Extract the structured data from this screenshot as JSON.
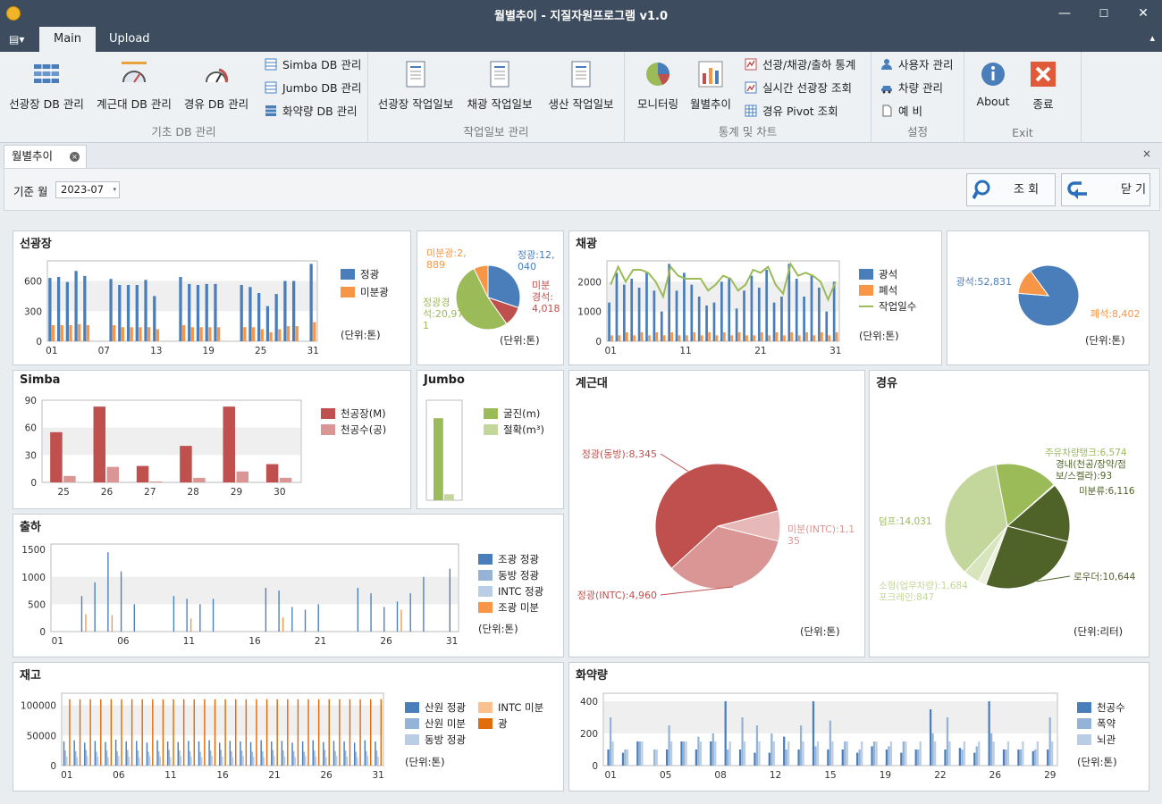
{
  "window": {
    "title": "월별추이 - 지질자원프로그램 v1.0",
    "min": "—",
    "max": "☐",
    "close": "✕"
  },
  "tabs": [
    {
      "label": "Main"
    },
    {
      "label": "Upload"
    }
  ],
  "ribbon": {
    "groups": [
      {
        "caption": "기초 DB 관리",
        "big": [
          {
            "label": "선광장 DB 관리",
            "icon": "list-db-icon"
          },
          {
            "label": "계근대 DB 관리",
            "icon": "gauge-icon"
          },
          {
            "label": "경유 DB 관리",
            "icon": "fuel-gauge-icon"
          }
        ],
        "small": [
          {
            "label": "Simba DB 관리",
            "icon": "grid-icon"
          },
          {
            "label": "Jumbo DB 관리",
            "icon": "grid-icon"
          },
          {
            "label": "화약량 DB 관리",
            "icon": "grid-icon"
          }
        ]
      },
      {
        "caption": "작업일보 관리",
        "big": [
          {
            "label": "선광장 작업일보",
            "icon": "report-icon"
          },
          {
            "label": "채광 작업일보",
            "icon": "report-icon"
          },
          {
            "label": "생산 작업일보",
            "icon": "report-icon"
          }
        ]
      },
      {
        "caption": "통계 및 차트",
        "big": [
          {
            "label": "모니터링",
            "icon": "pie-chart-icon"
          },
          {
            "label": "월별추이",
            "icon": "bar-chart-icon"
          }
        ],
        "small": [
          {
            "label": "선광/채광/출하 통계",
            "icon": "stats-icon"
          },
          {
            "label": "실시간 선광장 조회",
            "icon": "line-chart-icon"
          },
          {
            "label": "경유 Pivot 조회",
            "icon": "table-icon"
          }
        ]
      },
      {
        "caption": "설정",
        "small": [
          {
            "label": "사용자 관리",
            "icon": "user-icon"
          },
          {
            "label": "차량 관리",
            "icon": "car-icon"
          },
          {
            "label": "예 비",
            "icon": "document-icon"
          }
        ]
      },
      {
        "caption": "Exit",
        "big": [
          {
            "label": "About",
            "icon": "info-icon"
          },
          {
            "label": "종료",
            "icon": "close-icon"
          }
        ]
      }
    ]
  },
  "doc_tab": {
    "label": "월별추이",
    "close": "×",
    "panel_close": "×"
  },
  "filter": {
    "label": "기준 월",
    "month": "2023-07",
    "arrow": "▾",
    "search_label": "조 회",
    "close_label": "닫 기"
  },
  "colors": {
    "blue": "#4a7ebb",
    "orange": "#f79646",
    "red": "#c0504d",
    "pink": "#d99694",
    "green": "#9bbb59",
    "lightgreen": "#c3d69b",
    "darkgreen": "#4f6228",
    "lightblue": "#b9cde5",
    "midblue": "#95b3d7",
    "peach": "#fac090"
  },
  "chart_data": [
    {
      "id": "sunkwang",
      "type": "bar",
      "title": "선광장",
      "unit": "(단위:톤)",
      "y_ticks": [
        "0",
        "300",
        "600"
      ],
      "x_ticks": [
        "01",
        "07",
        "13",
        "19",
        "25",
        "31"
      ],
      "ylim": [
        0,
        800
      ],
      "series": [
        {
          "name": "정광",
          "color": "#4a7ebb",
          "values": [
            630,
            640,
            590,
            700,
            650,
            0,
            0,
            620,
            560,
            560,
            560,
            610,
            450,
            0,
            0,
            640,
            570,
            560,
            570,
            570,
            0,
            0,
            560,
            540,
            480,
            350,
            470,
            600,
            600,
            0,
            770
          ]
        },
        {
          "name": "미분광",
          "color": "#f79646",
          "values": [
            160,
            160,
            160,
            170,
            160,
            0,
            0,
            160,
            140,
            140,
            140,
            140,
            120,
            0,
            0,
            160,
            140,
            140,
            140,
            140,
            0,
            0,
            140,
            140,
            120,
            90,
            120,
            150,
            150,
            0,
            190
          ]
        }
      ]
    },
    {
      "id": "sunkwang-pie",
      "type": "pie",
      "unit": "(단위:톤)",
      "slices": [
        {
          "name": "정광",
          "value": 12040,
          "label": "정광:12,040",
          "color": "#4a7ebb"
        },
        {
          "name": "미분경석",
          "value": 4018,
          "label": "미분경석:4,018",
          "color": "#c0504d"
        },
        {
          "name": "정광경석",
          "value": 20971,
          "label": "정광경석:20,971",
          "color": "#9bbb59"
        },
        {
          "name": "미분광",
          "value": 2889,
          "label": "미분광:2,889",
          "color": "#f79646"
        }
      ]
    },
    {
      "id": "chaekwang",
      "type": "bar",
      "title": "채광",
      "unit": "(단위:톤)",
      "y_ticks": [
        "0",
        "1000",
        "2000"
      ],
      "x_ticks": [
        "01",
        "11",
        "21",
        "31"
      ],
      "ylim": [
        0,
        2700
      ],
      "series": [
        {
          "name": "광석",
          "color": "#4a7ebb",
          "values": [
            1300,
            2300,
            1900,
            2100,
            1800,
            2300,
            1700,
            1000,
            2600,
            1700,
            2300,
            1900,
            1500,
            1200,
            1300,
            2000,
            2100,
            1100,
            1700,
            2200,
            1800,
            2400,
            1300,
            1500,
            2600,
            2100,
            1500,
            2200,
            1800,
            1000,
            2000
          ]
        },
        {
          "name": "폐석",
          "color": "#f79646",
          "values": [
            200,
            200,
            300,
            200,
            300,
            200,
            300,
            200,
            300,
            200,
            200,
            300,
            200,
            300,
            200,
            300,
            200,
            300,
            200,
            200,
            300,
            200,
            300,
            200,
            300,
            200,
            300,
            200,
            300,
            200,
            300
          ]
        },
        {
          "name": "작업일수",
          "color": "#9bbb59",
          "line": true,
          "values": [
            1900,
            2500,
            2000,
            2400,
            2400,
            2300,
            2000,
            1500,
            2500,
            2200,
            2100,
            2100,
            2100,
            1700,
            1900,
            2200,
            2100,
            1700,
            1900,
            2400,
            2300,
            2500,
            1900,
            1600,
            2600,
            2200,
            2300,
            2200,
            2000,
            1400,
            2000
          ]
        }
      ]
    },
    {
      "id": "chaekwang-pie",
      "type": "pie",
      "unit": "(단위:톤)",
      "slices": [
        {
          "name": "광석",
          "value": 52831,
          "label": "광석:52,831",
          "color": "#4a7ebb"
        },
        {
          "name": "폐석",
          "value": 8402,
          "label": "폐석:8,402",
          "color": "#f79646"
        }
      ]
    },
    {
      "id": "simba",
      "type": "bar",
      "title": "Simba",
      "y_ticks": [
        "0",
        "30",
        "60",
        "90"
      ],
      "x_ticks": [
        "25",
        "26",
        "27",
        "28",
        "29",
        "30"
      ],
      "ylim": [
        0,
        90
      ],
      "series": [
        {
          "name": "천공장(M)",
          "color": "#c0504d",
          "values": [
            55,
            83,
            18,
            40,
            83,
            20
          ]
        },
        {
          "name": "천공수(공)",
          "color": "#d99694",
          "values": [
            7,
            17,
            1,
            5,
            12,
            5
          ]
        }
      ]
    },
    {
      "id": "jumbo",
      "type": "bar",
      "title": "Jumbo",
      "ylim": [
        0,
        100
      ],
      "series": [
        {
          "name": "굴진(m)",
          "color": "#9bbb59",
          "values": [
            82
          ]
        },
        {
          "name": "절확(m³)",
          "color": "#c3d69b",
          "values": [
            6
          ]
        }
      ]
    },
    {
      "id": "gyegeundae",
      "type": "pie",
      "title": "계근대",
      "unit": "(단위:톤)",
      "slices": [
        {
          "name": "미분(INTC)",
          "value": 1135,
          "label": "미분(INTC):1,135",
          "color": "#e6b9b8"
        },
        {
          "name": "정광(INTC)",
          "value": 4960,
          "label": "정광(INTC):4,960",
          "color": "#d99694"
        },
        {
          "name": "정광(동방)",
          "value": 8345,
          "label": "정광(동방):8,345",
          "color": "#c0504d"
        }
      ]
    },
    {
      "id": "gyeongyu",
      "type": "pie",
      "title": "경유",
      "unit": "(단위:리터)",
      "slices": [
        {
          "name": "주유차량탱크",
          "value": 6574,
          "label": "주유차량탱크:6,574",
          "color": "#9bbb59"
        },
        {
          "name": "경내(천공/장약/점보/스켈라)",
          "value": 93,
          "label": "경내(천공/장약/점보/스켈라):93",
          "color": "#76923c"
        },
        {
          "name": "미분류",
          "value": 6116,
          "label": "미분류:6,116",
          "color": "#4f6228"
        },
        {
          "name": "로우더",
          "value": 10644,
          "label": "로우더:10,644",
          "color": "#4f6228"
        },
        {
          "name": "포크레인",
          "value": 847,
          "label": "포크레인:847",
          "color": "#ebf1de"
        },
        {
          "name": "소형(업무차량)",
          "value": 1684,
          "label": "소형(업무차량):1,684",
          "color": "#d7e4bc"
        },
        {
          "name": "덤프",
          "value": 14031,
          "label": "덤프:14,031",
          "color": "#c3d69b"
        }
      ]
    },
    {
      "id": "chulha",
      "type": "bar",
      "title": "출하",
      "unit": "(단위:톤)",
      "y_ticks": [
        "0",
        "500",
        "1000",
        "1500"
      ],
      "x_ticks": [
        "01",
        "06",
        "11",
        "16",
        "21",
        "26",
        "31"
      ],
      "ylim": [
        0,
        1600
      ],
      "series": [
        {
          "name": "조광 정광",
          "color": "#4a7ebb",
          "values": [
            0,
            0,
            650,
            900,
            1450,
            1100,
            500,
            0,
            0,
            650,
            600,
            500,
            600,
            0,
            0,
            0,
            800,
            750,
            450,
            400,
            500,
            0,
            0,
            800,
            700,
            450,
            550,
            700,
            1000,
            0,
            1150
          ]
        },
        {
          "name": "동방 정광",
          "color": "#95b3d7",
          "values": [
            0,
            0,
            0,
            0,
            0,
            0,
            0,
            0,
            0,
            0,
            0,
            0,
            0,
            0,
            0,
            0,
            0,
            0,
            0,
            0,
            0,
            0,
            0,
            0,
            0,
            0,
            0,
            0,
            0,
            0,
            0
          ]
        },
        {
          "name": "INTC 정광",
          "color": "#b9cde5",
          "values": [
            0,
            0,
            0,
            0,
            0,
            0,
            0,
            0,
            0,
            0,
            0,
            0,
            0,
            0,
            0,
            0,
            0,
            0,
            0,
            0,
            0,
            0,
            0,
            0,
            0,
            0,
            0,
            0,
            0,
            0,
            0
          ]
        },
        {
          "name": "조광 미분",
          "color": "#f79646",
          "values": [
            0,
            0,
            320,
            0,
            300,
            0,
            0,
            0,
            0,
            0,
            240,
            0,
            0,
            0,
            0,
            0,
            0,
            260,
            0,
            0,
            0,
            0,
            0,
            0,
            0,
            0,
            400,
            0,
            0,
            0,
            0
          ]
        }
      ]
    },
    {
      "id": "jaego",
      "type": "bar",
      "title": "재고",
      "unit": "(단위:톤)",
      "y_ticks": [
        "0",
        "50000",
        "100000"
      ],
      "x_ticks": [
        "01",
        "06",
        "11",
        "16",
        "21",
        "26",
        "31"
      ],
      "ylim": [
        0,
        120000
      ],
      "series": [
        {
          "name": "산원 정광",
          "color": "#4a7ebb",
          "values": [
            40000,
            42000,
            38000,
            41000,
            39000,
            43000,
            40000,
            41000,
            38000,
            42000,
            40000,
            39000,
            41000,
            40000,
            42000,
            38000,
            41000,
            40000,
            39000,
            42000,
            40000,
            41000,
            38000,
            40000,
            42000,
            39000,
            41000,
            40000,
            38000,
            42000,
            40000
          ]
        },
        {
          "name": "산원 미분",
          "color": "#95b3d7",
          "values": [
            25000,
            24000,
            26000,
            23000,
            25000,
            24000,
            26000,
            25000,
            23000,
            24000,
            26000,
            25000,
            24000,
            23000,
            25000,
            26000,
            24000,
            25000,
            23000,
            24000,
            26000,
            25000,
            24000,
            23000,
            25000,
            26000,
            24000,
            25000,
            23000,
            24000,
            25000
          ]
        },
        {
          "name": "동방 정광",
          "color": "#b9cde5",
          "values": [
            15000,
            14000,
            16000,
            15000,
            14000,
            16000,
            15000,
            14000,
            16000,
            15000,
            14000,
            16000,
            15000,
            14000,
            16000,
            15000,
            14000,
            16000,
            15000,
            14000,
            16000,
            15000,
            14000,
            16000,
            15000,
            14000,
            16000,
            15000,
            14000,
            16000,
            15000
          ]
        },
        {
          "name": "INTC 미분",
          "color": "#fac090",
          "values": [
            0,
            0,
            0,
            0,
            0,
            0,
            0,
            0,
            0,
            0,
            0,
            0,
            0,
            0,
            0,
            0,
            0,
            0,
            0,
            0,
            0,
            0,
            0,
            0,
            0,
            0,
            0,
            0,
            0,
            0,
            0
          ]
        },
        {
          "name": "광",
          "color": "#e26b0a",
          "values": [
            110000,
            110000,
            110000,
            110000,
            110000,
            110000,
            110000,
            110000,
            110000,
            110000,
            110000,
            110000,
            110000,
            110000,
            110000,
            110000,
            110000,
            110000,
            110000,
            110000,
            110000,
            110000,
            110000,
            110000,
            110000,
            110000,
            110000,
            110000,
            110000,
            110000,
            110000
          ]
        }
      ]
    },
    {
      "id": "hwayak",
      "type": "bar",
      "title": "화약량",
      "unit": "(단위:톤)",
      "y_ticks": [
        "0",
        "200",
        "400"
      ],
      "x_ticks": [
        "01",
        "05",
        "08",
        "12",
        "15",
        "19",
        "22",
        "26",
        "29"
      ],
      "ylim": [
        0,
        450
      ],
      "series": [
        {
          "name": "천공수",
          "color": "#4a7ebb",
          "values": [
            100,
            80,
            150,
            0,
            100,
            150,
            100,
            150,
            400,
            100,
            80,
            80,
            180,
            100,
            400,
            100,
            100,
            80,
            120,
            100,
            80,
            100,
            350,
            100,
            110,
            80,
            400,
            100,
            100,
            90,
            100
          ]
        },
        {
          "name": "폭약",
          "color": "#95b3d7",
          "values": [
            300,
            100,
            150,
            100,
            250,
            150,
            180,
            200,
            100,
            300,
            250,
            200,
            100,
            250,
            120,
            280,
            150,
            100,
            150,
            120,
            150,
            100,
            200,
            300,
            100,
            120,
            200,
            100,
            100,
            100,
            300
          ]
        },
        {
          "name": "뇌관",
          "color": "#b9cde5",
          "values": [
            150,
            100,
            150,
            100,
            150,
            150,
            150,
            150,
            150,
            150,
            150,
            150,
            150,
            150,
            150,
            150,
            150,
            150,
            150,
            150,
            150,
            150,
            150,
            150,
            150,
            150,
            150,
            150,
            150,
            150,
            150
          ]
        }
      ]
    }
  ]
}
